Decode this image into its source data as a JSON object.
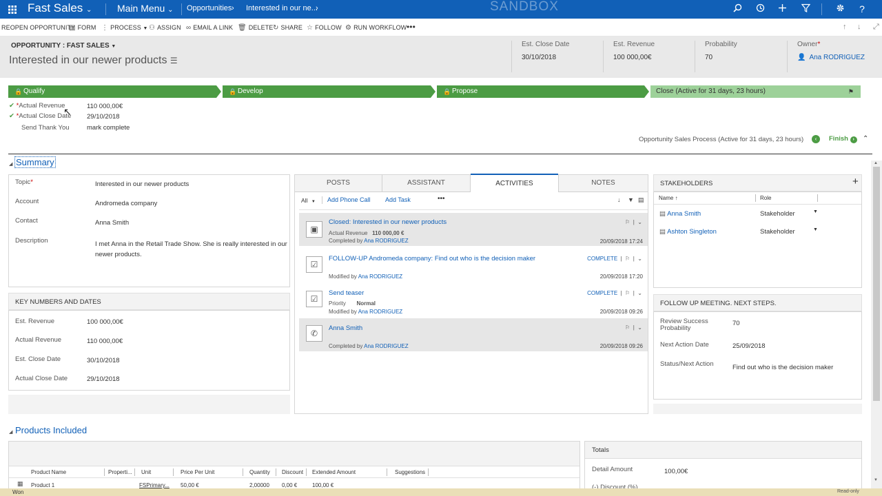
{
  "nav": {
    "app_name": "Fast Sales",
    "main_menu": "Main Menu",
    "breadcrumb_1": "Opportunities",
    "breadcrumb_2": "Interested in our ne...",
    "sandbox": "SANDBOX",
    "accent": "#1160b7"
  },
  "commands": {
    "reopen": "REOPEN OPPORTUNITY",
    "form": "FORM",
    "process": "PROCESS",
    "assign": "ASSIGN",
    "email_link": "EMAIL A LINK",
    "delete": "DELETE",
    "share": "SHARE",
    "follow": "FOLLOW",
    "run_workflow": "RUN WORKFLOW"
  },
  "header": {
    "entity_type": "OPPORTUNITY : FAST SALES",
    "title": "Interested in our newer products",
    "fields": [
      {
        "label": "Est. Close Date",
        "value": "30/10/2018"
      },
      {
        "label": "Est. Revenue",
        "value": "100 000,00€"
      },
      {
        "label": "Probability",
        "value": "70"
      },
      {
        "label": "Owner",
        "value": "Ana RODRIGUEZ"
      }
    ],
    "owner_required": "*"
  },
  "bpf": {
    "stages": [
      "Qualify",
      "Develop",
      "Propose",
      "Close (Active for 31 days, 23 hours)"
    ],
    "steps": [
      {
        "label": "Actual Revenue",
        "value": "110 000,00€",
        "required": "*"
      },
      {
        "label": "Actual Close Date",
        "value": "29/10/2018",
        "required": "*"
      },
      {
        "label": "Send Thank You",
        "value": "mark complete"
      }
    ],
    "process_label": "Opportunity Sales Process (Active for 31 days, 23 hours)",
    "finish": "Finish",
    "green": "#4c9c44"
  },
  "summary": {
    "title": "Summary",
    "fields": [
      {
        "label": "Topic",
        "value": "Interested in our newer products"
      },
      {
        "label": "Account",
        "value": "Andromeda company"
      },
      {
        "label": "Contact",
        "value": "Anna Smith"
      },
      {
        "label": "Description",
        "value_line1": "I met Anna in the Retail Trade Show. She is really interested in our",
        "value_line2": "newer products."
      }
    ],
    "topic_required": "*"
  },
  "key_numbers": {
    "title": "KEY NUMBERS AND DATES",
    "fields": [
      {
        "label": "Est. Revenue",
        "value": "100 000,00€"
      },
      {
        "label": "Actual Revenue",
        "value": "110 000,00€"
      },
      {
        "label": "Est. Close Date",
        "value": "30/10/2018"
      },
      {
        "label": "Actual Close Date",
        "value": "29/10/2018"
      }
    ]
  },
  "timeline": {
    "tabs": [
      "POSTS",
      "ASSISTANT",
      "ACTIVITIES",
      "NOTES"
    ],
    "filter": "All",
    "add_phone_call": "Add Phone Call",
    "add_task": "Add Task",
    "activities": [
      {
        "title": "Closed: Interested in our newer products",
        "line1_label": "Actual Revenue",
        "line1_value": "110 000,00 €",
        "by_label": "Completed by",
        "by": "Ana RODRIGUEZ",
        "date": "20/09/2018 17:24"
      },
      {
        "title": "FOLLOW-UP Andromeda company: Find out who is the decision maker",
        "complete": "COMPLETE",
        "by_label": "Modified by",
        "by": "Ana RODRIGUEZ",
        "date": "20/09/2018 17:20"
      },
      {
        "title": "Send teaser",
        "complete": "COMPLETE",
        "line1_label": "Priority",
        "line1_value": "Normal",
        "by_label": "Modified by",
        "by": "Ana RODRIGUEZ",
        "date": "20/09/2018 09:26"
      },
      {
        "title": "Anna Smith",
        "by_label": "Completed by",
        "by": "Ana RODRIGUEZ",
        "date": "20/09/2018 09:26"
      }
    ]
  },
  "stakeholders": {
    "title": "STAKEHOLDERS",
    "col_name": "Name ↑",
    "col_role": "Role",
    "rows": [
      {
        "name": "Anna Smith",
        "role": "Stakeholder"
      },
      {
        "name": "Ashton Singleton",
        "role": "Stakeholder"
      }
    ]
  },
  "followup": {
    "title": "FOLLOW UP MEETING. NEXT STEPS.",
    "fields": [
      {
        "label_line1": "Review Success",
        "label_line2": "Probability",
        "value": "70"
      },
      {
        "label_line1": "Next Action Date",
        "value": "25/09/2018"
      },
      {
        "label_line1": "Status/Next Action",
        "value": "Find out who is the decision maker"
      }
    ]
  },
  "products": {
    "title": "Products Included",
    "columns": [
      "Product Name",
      "Properti...",
      "Unit",
      "Price Per Unit",
      "Quantity",
      "Discount",
      "Extended Amount",
      "Suggestions"
    ],
    "row": [
      "Product 1",
      "",
      "FSPrimary...",
      "50,00 €",
      "2,00000",
      "0,00 €",
      "100,00 €",
      ""
    ]
  },
  "totals": {
    "title": "Totals",
    "detail_label": "Detail Amount",
    "detail_value": "100,00€",
    "discount_label": "(-) Discount (%)"
  },
  "status_bar": {
    "state": "Won",
    "mode": "Read-only"
  }
}
